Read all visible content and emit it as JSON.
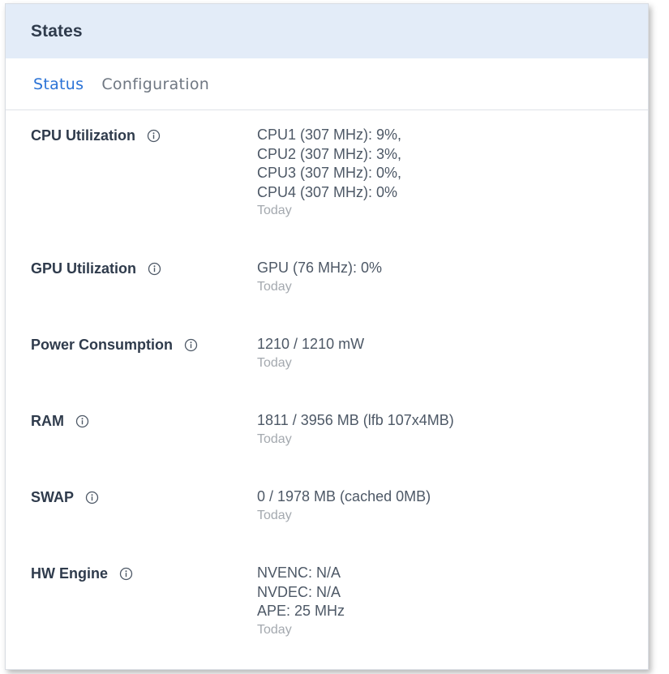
{
  "panel": {
    "title": "States"
  },
  "tabs": [
    {
      "label": "Status",
      "active": true
    },
    {
      "label": "Configuration",
      "active": false
    }
  ],
  "rows": [
    {
      "label": "CPU Utilization",
      "values": [
        "CPU1 (307 MHz): 9%,",
        "CPU2 (307 MHz): 3%,",
        "CPU3 (307 MHz): 0%,",
        "CPU4 (307 MHz): 0%"
      ],
      "timestamp": "Today"
    },
    {
      "label": "GPU Utilization",
      "values": [
        "GPU (76 MHz): 0%"
      ],
      "timestamp": "Today"
    },
    {
      "label": "Power Consumption",
      "values": [
        "1210 / 1210 mW"
      ],
      "timestamp": "Today"
    },
    {
      "label": "RAM",
      "values": [
        "1811 / 3956 MB (lfb 107x4MB)"
      ],
      "timestamp": "Today"
    },
    {
      "label": "SWAP",
      "values": [
        "0 / 1978 MB (cached 0MB)"
      ],
      "timestamp": "Today"
    },
    {
      "label": "HW Engine",
      "values": [
        "NVENC: N/A",
        "NVDEC: N/A",
        "APE: 25 MHz"
      ],
      "timestamp": "Today"
    }
  ],
  "colors": {
    "header_bg": "#e3ecf8",
    "active_tab": "#2b73d6",
    "inactive_tab": "#6f7782",
    "label_text": "#2f3b4c",
    "value_text": "#4d5866",
    "timestamp_text": "#a4a9af"
  },
  "icons": {
    "info": "info-circle-icon"
  }
}
